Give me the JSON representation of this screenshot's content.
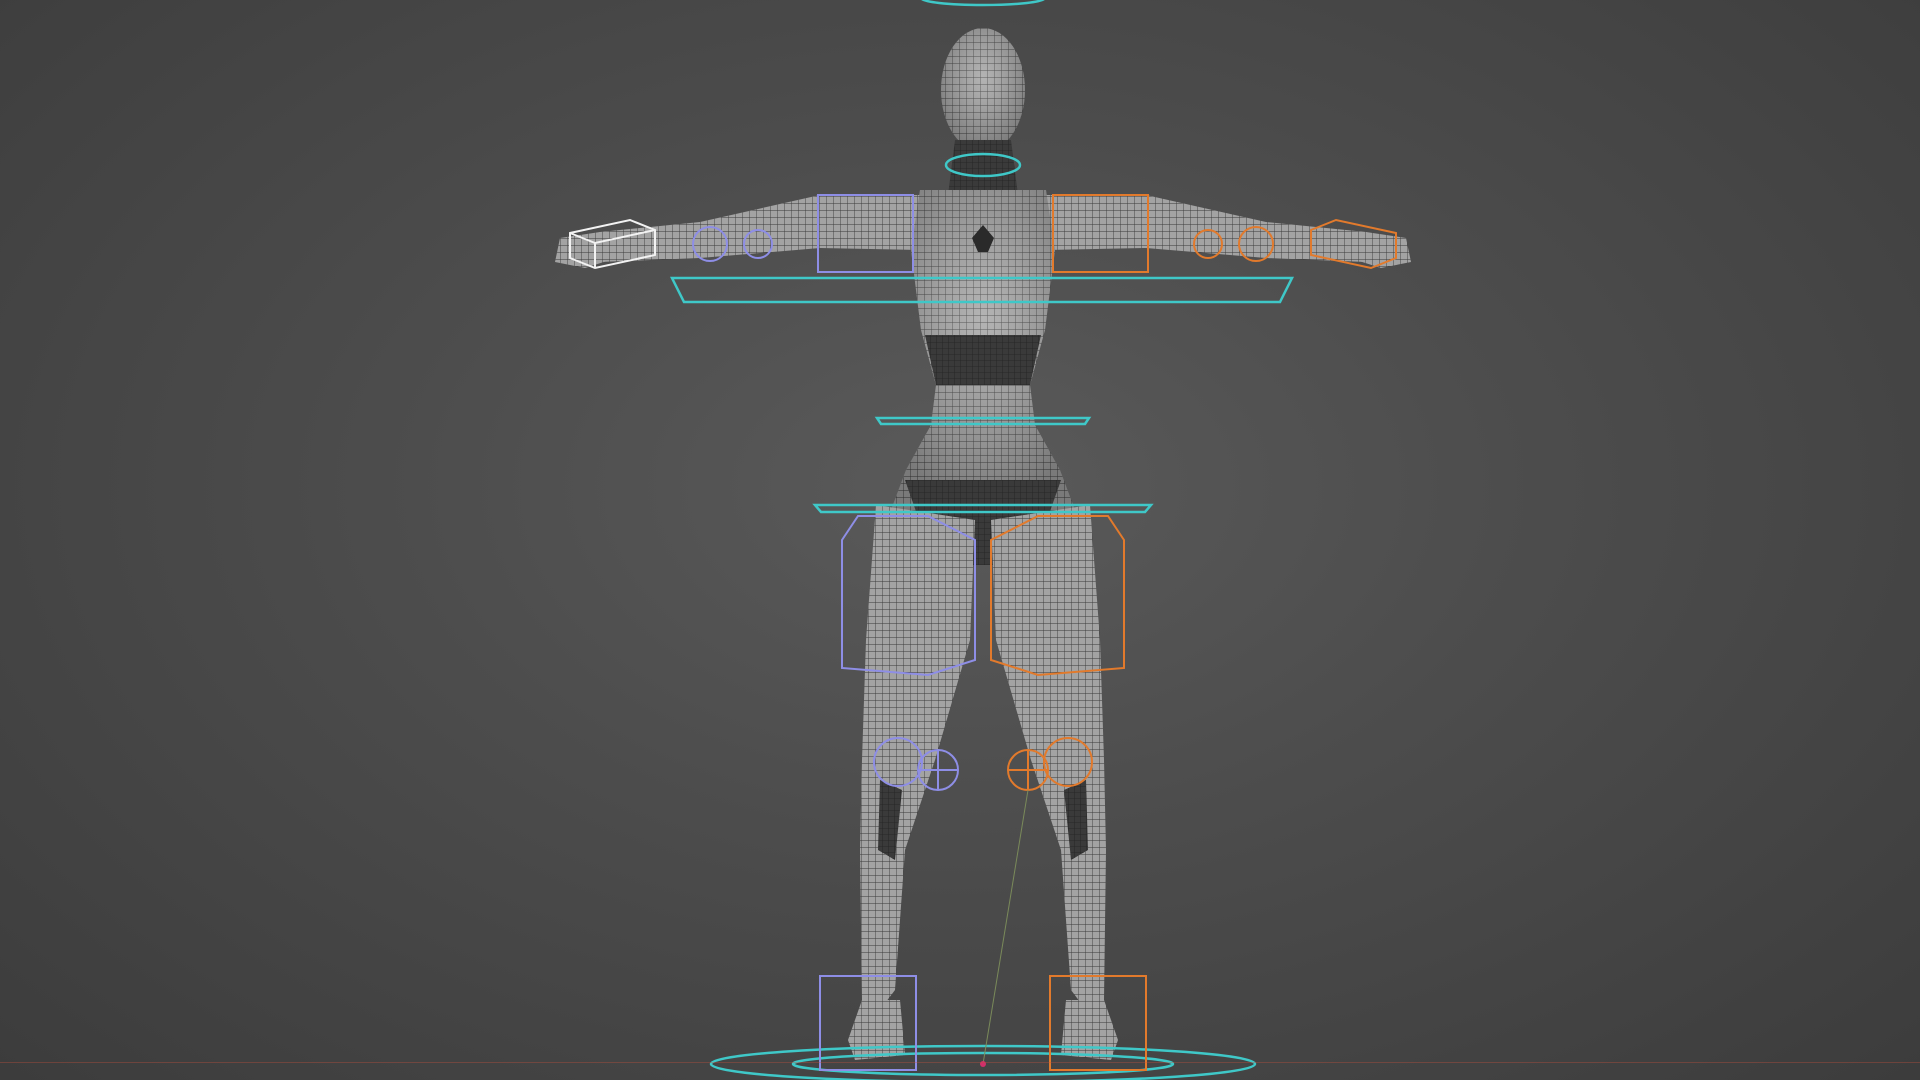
{
  "viewport": {
    "background": "#474747",
    "mode": "wireframe",
    "show_grid_floor": true
  },
  "colors": {
    "mesh_fill": "#9a9a9a",
    "mesh_wire": "#3b3b3b",
    "mesh_dark": "#2e2e2e",
    "control_center": "#3fc8c8",
    "control_left": "#8e8ee6",
    "control_right": "#e27a2c",
    "control_selected": "#f2f2f2",
    "floor_axis": "#c8503c"
  },
  "rig": {
    "controls": [
      {
        "name": "head-control",
        "side": "center",
        "shape": "ellipse"
      },
      {
        "name": "neck-control",
        "side": "center",
        "shape": "ellipse"
      },
      {
        "name": "chest-control",
        "side": "center",
        "shape": "plate"
      },
      {
        "name": "waist-control",
        "side": "center",
        "shape": "plate"
      },
      {
        "name": "hip-control",
        "side": "center",
        "shape": "plate"
      },
      {
        "name": "root-control",
        "side": "center",
        "shape": "ellipse"
      },
      {
        "name": "shoulder-left-control",
        "side": "left",
        "shape": "box"
      },
      {
        "name": "shoulder-right-control",
        "side": "right",
        "shape": "box"
      },
      {
        "name": "hand-left-control",
        "side": "left",
        "shape": "box"
      },
      {
        "name": "hand-right-control",
        "side": "right",
        "shape": "box"
      },
      {
        "name": "thigh-left-control",
        "side": "left",
        "shape": "box"
      },
      {
        "name": "thigh-right-control",
        "side": "right",
        "shape": "box"
      },
      {
        "name": "knee-left-pole",
        "side": "left",
        "shape": "crosshair"
      },
      {
        "name": "knee-right-pole",
        "side": "right",
        "shape": "crosshair"
      },
      {
        "name": "foot-left-control",
        "side": "left",
        "shape": "box"
      },
      {
        "name": "foot-right-control",
        "side": "right",
        "shape": "box"
      }
    ]
  }
}
